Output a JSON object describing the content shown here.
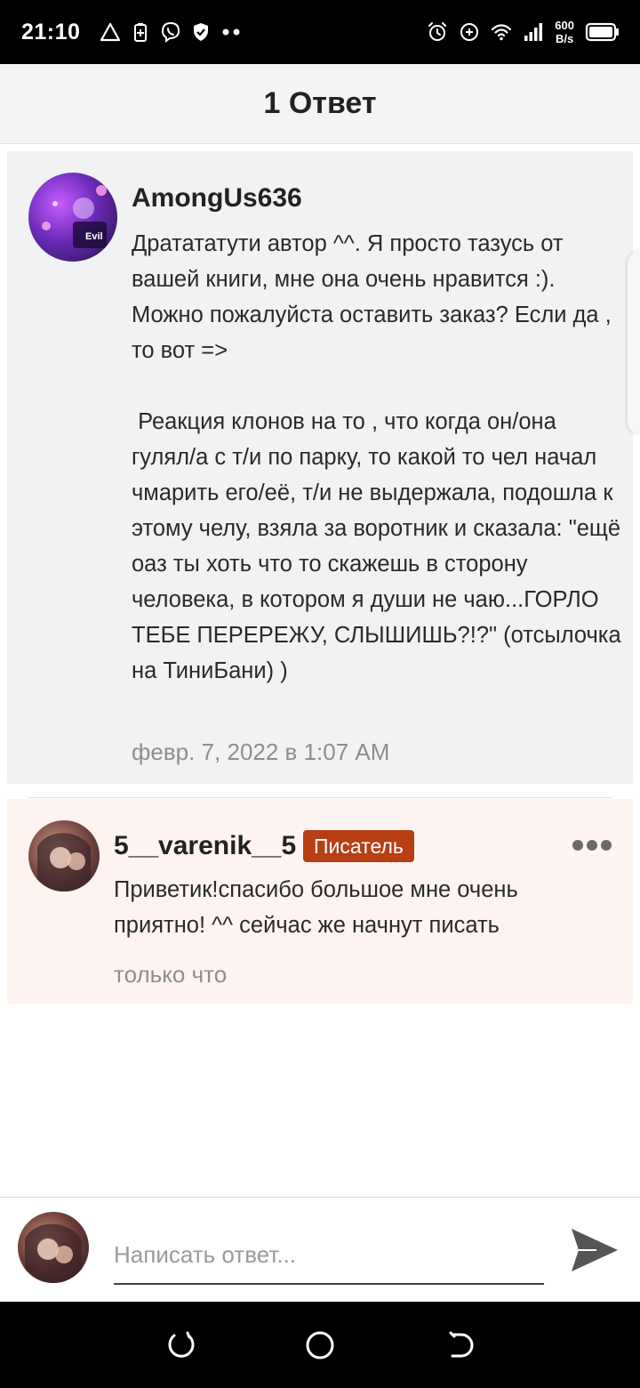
{
  "status_bar": {
    "time": "21:10",
    "network_speed_value": "600",
    "network_speed_unit": "B/s",
    "left_icons": [
      "warning-triangle-icon",
      "battery-saver-icon",
      "viber-icon",
      "shield-check-icon",
      "more-notifications-icon"
    ],
    "right_icons": [
      "alarm-icon",
      "data-saver-icon",
      "wifi-icon",
      "cell-signal-icon",
      "battery-icon"
    ]
  },
  "header": {
    "title": "1 Ответ"
  },
  "parent_comment": {
    "username": "AmongUs636",
    "text": "Дратататути автор ^^. Я просто тазусь от вашей книги, мне она очень нравится :). Можно пожалуйста оставить заказ? Если да , то вот =>\n\n Реакция клонов на то , что когда он/она гулял/а с т/и по парку, то какой то чел начал чмарить его/её, т/и не выдержала, подошла к этому челу, взяла за воротник и сказала: \"ещё оаз ты хоть что то скажешь в сторону человека, в котором я души не чаю...ГОРЛО ТЕБЕ ПЕРЕРЕЖУ, СЛЫШИШЬ?!?\" (отсылочка на ТиниБани) )",
    "timestamp": "февр. 7, 2022 в 1:07 AM",
    "avatar_label": "Evil"
  },
  "reply_comment": {
    "username": "5__varenik__5",
    "badge": "Писатель",
    "text": "Приветик!спасибо большое мне очень приятно! ^^ сейчас же начнут писать",
    "timestamp": "только что",
    "more_icon": "more-horizontal-icon"
  },
  "composer": {
    "placeholder": "Написать ответ...",
    "send_icon": "send-icon"
  },
  "nav_bar": {
    "icons": [
      "recents-icon",
      "home-icon",
      "back-icon"
    ]
  },
  "colors": {
    "badge": "#b83f14",
    "parent_bg": "#f2f2f4",
    "reply_bg": "#fdf4f1",
    "header_bg": "#f4f4f4"
  }
}
